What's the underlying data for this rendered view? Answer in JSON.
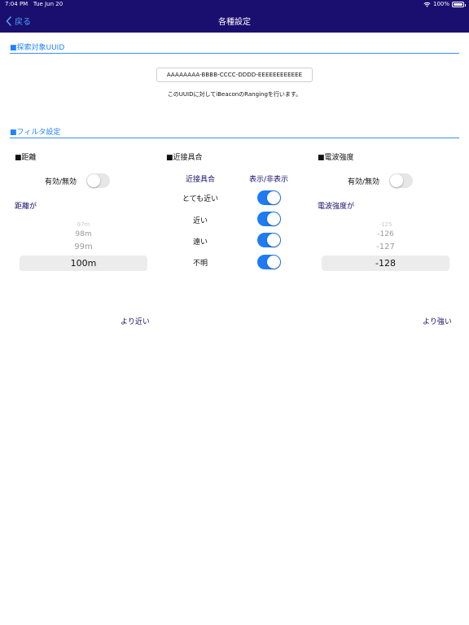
{
  "status_bar": {
    "time": "7:04 PM",
    "date": "Tue Jun 20",
    "battery": "100%",
    "battery_fraction": 1.0
  },
  "nav": {
    "back_label": "戻る",
    "title": "各種設定"
  },
  "uuid_section": {
    "header": "■探索対象UUID",
    "uuid_value": "AAAAAAAA-BBBB-CCCC-DDDD-EEEEEEEEEEEE",
    "description": "このUUIDに対してiBeaconのRangingを行います。"
  },
  "filter_section": {
    "header": "■フィルタ設定",
    "distance": {
      "heading": "■距離",
      "enable_label": "有効/無効",
      "enabled": false,
      "condition_label": "距離が",
      "picker_values": [
        "97m",
        "98m",
        "99m"
      ],
      "selected": "100m",
      "direction_link": "より近い"
    },
    "proximity": {
      "heading": "■近接具合",
      "column_label": "近接具合",
      "column_visibility": "表示/非表示",
      "items": [
        {
          "label": "とても近い",
          "on": true
        },
        {
          "label": "近い",
          "on": true
        },
        {
          "label": "遠い",
          "on": true
        },
        {
          "label": "不明",
          "on": true
        }
      ]
    },
    "rssi": {
      "heading": "■電波強度",
      "enable_label": "有効/無効",
      "enabled": false,
      "condition_label": "電波強度が",
      "picker_values": [
        "-125",
        "-126",
        "-127"
      ],
      "selected": "-128",
      "direction_link": "より強い"
    }
  }
}
